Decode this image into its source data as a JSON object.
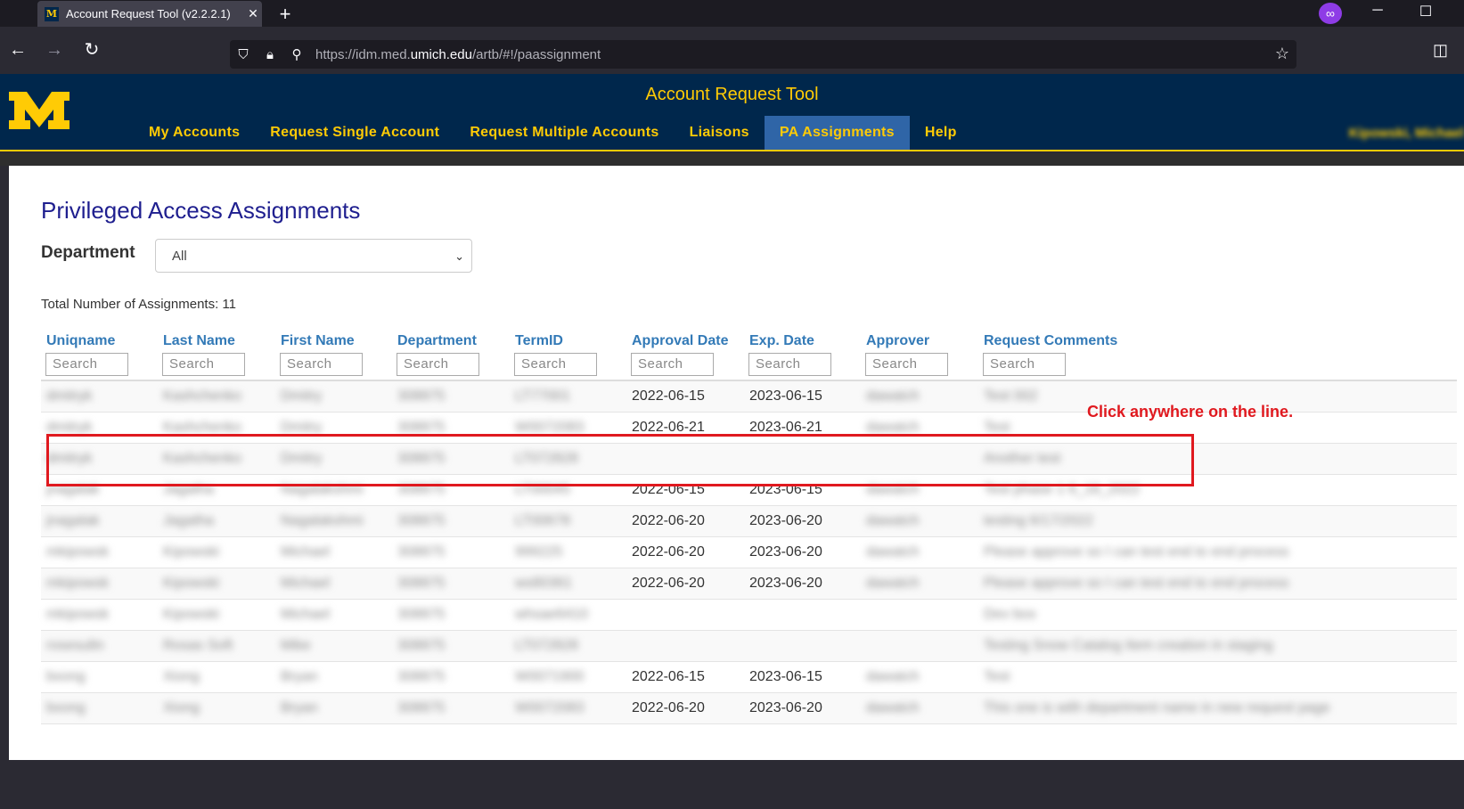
{
  "browser": {
    "tab_title": "Account Request Tool (v2.2.2.1)",
    "tab_close": "✕",
    "new_tab": "+",
    "favicon": "M",
    "url_prefix": "https://idm.med.",
    "url_domain": "umich.edu",
    "url_suffix": "/artb/#!/paassignment",
    "icons": [
      "back-arrow-icon",
      "forward-arrow-icon",
      "reload-icon",
      "shield-icon",
      "lock-icon",
      "permissions-icon",
      "star-icon",
      "pocket-icon"
    ]
  },
  "app": {
    "title": "Account Request Tool",
    "menu": [
      "My Accounts",
      "Request Single Account",
      "Request Multiple Accounts",
      "Liaisons",
      "PA Assignments",
      "Help"
    ],
    "active_menu": "PA Assignments",
    "user": "Kipowski, Michael",
    "colors": {
      "navy": "#00274c",
      "maize": "#ffcb05",
      "active_tab": "#2f65a7",
      "link_blue": "#337ab7",
      "title_blue": "#1f1f8f",
      "annotation_red": "#e0191f"
    }
  },
  "page": {
    "title": "Privileged Access Assignments",
    "department_label": "Department",
    "department_value": "All",
    "total_label": "Total Number of Assignments: 11"
  },
  "table": {
    "columns": [
      "Uniqname",
      "Last Name",
      "First Name",
      "Department",
      "TermID",
      "Approval Date",
      "Exp. Date",
      "Approver",
      "Request Comments"
    ],
    "search_placeholder": "Search",
    "rows": [
      [
        "dmitryk",
        "Kashchenko",
        "Dmitry",
        "308875",
        "LT77001",
        "2022-06-15",
        "2023-06-15",
        "dawatch",
        "Test 002"
      ],
      [
        "dmitryk",
        "Kashchenko",
        "Dmitry",
        "308875",
        "W0072083",
        "2022-06-21",
        "2023-06-21",
        "dawatch",
        "Test"
      ],
      [
        "dmitryk",
        "Kashchenko",
        "Dmitry",
        "308875",
        "LT072828",
        "",
        "",
        "",
        "Another test"
      ],
      [
        "jnagalak",
        "Jagatha",
        "Nagalakshmi",
        "308875",
        "LT00045",
        "2022-06-15",
        "2023-06-15",
        "dawatch",
        "Test phase 1 6_16_2022"
      ],
      [
        "jnagalak",
        "Jagatha",
        "Nagalakshmi",
        "308875",
        "LT00678",
        "2022-06-20",
        "2023-06-20",
        "dawatch",
        "testing 6/17/2022"
      ],
      [
        "mkipowsk",
        "Kipowski",
        "Michael",
        "308875",
        "999225",
        "2022-06-20",
        "2023-06-20",
        "dawatch",
        "Please approve so I can test end to end process"
      ],
      [
        "mkipowsk",
        "Kipowski",
        "Michael",
        "308875",
        "ws80361",
        "2022-06-20",
        "2023-06-20",
        "dawatch",
        "Please approve so I can test end to end process"
      ],
      [
        "mkipowsk",
        "Kipowski",
        "Michael",
        "308875",
        "whsae6410",
        "",
        "",
        "",
        "Dev box"
      ],
      [
        "rosesultn",
        "Rosas Soft",
        "Mike",
        "308875",
        "LT072828",
        "",
        "",
        "",
        "Testing Snow Catalog Item creation in staging"
      ],
      [
        "bxong",
        "Xiong",
        "Bryan",
        "308875",
        "W0071900",
        "2022-06-15",
        "2023-06-15",
        "dawatch",
        "Test"
      ],
      [
        "bxong",
        "Xiong",
        "Bryan",
        "308875",
        "W0072083",
        "2022-06-20",
        "2023-06-20",
        "dawatch",
        "This one is with department name in new request page"
      ]
    ]
  },
  "annotation": {
    "text": "Click anywhere on the line."
  }
}
